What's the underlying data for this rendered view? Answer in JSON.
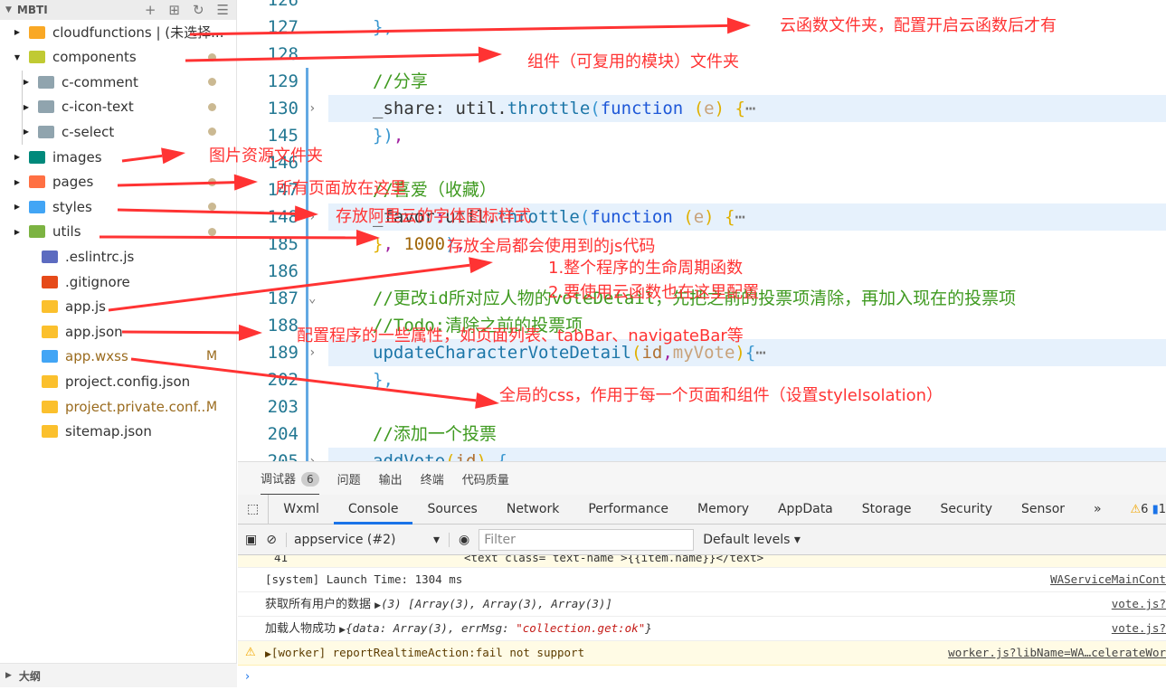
{
  "sidebar": {
    "project": "MBTI",
    "items": [
      {
        "label": "cloudfunctions | (未选择...",
        "icon": "cloud-folder-icon",
        "color": "#f9a825",
        "open": false,
        "depth": 0
      },
      {
        "label": "components",
        "icon": "components-folder-icon",
        "color": "#c0ca33",
        "open": true,
        "depth": 0,
        "dot": true
      },
      {
        "label": "c-comment",
        "icon": "folder-icon",
        "color": "#90a4ae",
        "open": false,
        "depth": 1,
        "dot": true
      },
      {
        "label": "c-icon-text",
        "icon": "folder-icon",
        "color": "#90a4ae",
        "open": false,
        "depth": 1,
        "dot": true
      },
      {
        "label": "c-select",
        "icon": "folder-icon",
        "color": "#90a4ae",
        "open": false,
        "depth": 1,
        "dot": true
      },
      {
        "label": "images",
        "icon": "images-folder-icon",
        "color": "#00897b",
        "open": false,
        "depth": 0
      },
      {
        "label": "pages",
        "icon": "pages-folder-icon",
        "color": "#ff7043",
        "open": false,
        "depth": 0,
        "dot": true
      },
      {
        "label": "styles",
        "icon": "styles-folder-icon",
        "color": "#42a5f5",
        "open": false,
        "depth": 0,
        "dot": true
      },
      {
        "label": "utils",
        "icon": "utils-folder-icon",
        "color": "#7cb342",
        "open": false,
        "depth": 0,
        "dot": true
      },
      {
        "label": ".eslintrc.js",
        "icon": "eslint-icon",
        "color": "#5c6bc0",
        "file": true
      },
      {
        "label": ".gitignore",
        "icon": "git-icon",
        "color": "#e64a19",
        "file": true
      },
      {
        "label": "app.js",
        "icon": "js-file-icon",
        "color": "#fbc02d",
        "file": true
      },
      {
        "label": "app.json",
        "icon": "json-file-icon",
        "color": "#fbc02d",
        "file": true
      },
      {
        "label": "app.wxss",
        "icon": "css-file-icon",
        "color": "#42a5f5",
        "file": true,
        "status": "M"
      },
      {
        "label": "project.config.json",
        "icon": "json-file-icon",
        "color": "#fbc02d",
        "file": true
      },
      {
        "label": "project.private.conf...",
        "icon": "json-file-icon",
        "color": "#fbc02d",
        "file": true,
        "status": "M"
      },
      {
        "label": "sitemap.json",
        "icon": "json-file-icon",
        "color": "#fbc02d",
        "file": true
      }
    ],
    "outline": "大纲"
  },
  "editor": {
    "lines": [
      {
        "n": "126",
        "tokens": []
      },
      {
        "n": "127",
        "tokens": [
          [
            "},",
            "br"
          ]
        ]
      },
      {
        "n": "128",
        "tokens": []
      },
      {
        "n": "129",
        "tokens": [
          [
            "//分享",
            "cm"
          ]
        ]
      },
      {
        "n": "130",
        "fold": "right",
        "hl": true,
        "tokens": [
          [
            "_share",
            "pl"
          ],
          [
            ": ",
            "pl"
          ],
          [
            "util",
            "pl"
          ],
          [
            ".",
            "pl"
          ],
          [
            "throttle",
            "fn"
          ],
          [
            "(",
            "br"
          ],
          [
            "function",
            "kw"
          ],
          [
            " ",
            "pl"
          ],
          [
            "(",
            "br2"
          ],
          [
            "e",
            "pm2"
          ],
          [
            ")",
            "br2"
          ],
          [
            " ",
            "pl"
          ],
          [
            "{",
            "br2"
          ],
          [
            "⋯",
            "gy"
          ]
        ]
      },
      {
        "n": "145",
        "tokens": [
          [
            "})",
            "br"
          ],
          [
            ",",
            "pu"
          ]
        ]
      },
      {
        "n": "146",
        "tokens": []
      },
      {
        "n": "147",
        "tokens": [
          [
            "//喜爱（收藏）",
            "cm"
          ]
        ]
      },
      {
        "n": "148",
        "fold": "right",
        "hl": true,
        "tokens": [
          [
            "_favor",
            "pl"
          ],
          [
            ":",
            "pu"
          ],
          [
            "util",
            "pl"
          ],
          [
            ".",
            "pl"
          ],
          [
            "throttle",
            "fn"
          ],
          [
            "(",
            "br"
          ],
          [
            "function",
            "kw"
          ],
          [
            " ",
            "pl"
          ],
          [
            "(",
            "br2"
          ],
          [
            "e",
            "pm2"
          ],
          [
            ")",
            "br2"
          ],
          [
            " ",
            "pl"
          ],
          [
            "{",
            "br2"
          ],
          [
            "⋯",
            "gy"
          ]
        ]
      },
      {
        "n": "185",
        "tokens": [
          [
            "}",
            "br2"
          ],
          [
            ", ",
            "pu"
          ],
          [
            "1000",
            "nm"
          ],
          [
            ")",
            "br"
          ],
          [
            ",",
            "pu"
          ]
        ]
      },
      {
        "n": "186",
        "tokens": []
      },
      {
        "n": "187",
        "fold": "down",
        "tokens": [
          [
            "//更改id所对应人物的voteDetail，先把之前的投票项清除，再加入现在的投票项",
            "cm"
          ]
        ]
      },
      {
        "n": "188",
        "tokens": [
          [
            "//Todo:清除之前的投票项",
            "cm"
          ]
        ]
      },
      {
        "n": "189",
        "fold": "right",
        "hl": true,
        "tokens": [
          [
            "updateCharacterVoteDetail",
            "fn"
          ],
          [
            "(",
            "br2"
          ],
          [
            "id",
            "pm"
          ],
          [
            ",",
            "pu"
          ],
          [
            "myVote",
            "pm2"
          ],
          [
            ")",
            "br2"
          ],
          [
            "{",
            "br"
          ],
          [
            "⋯",
            "gy"
          ]
        ]
      },
      {
        "n": "202",
        "tokens": [
          [
            "},",
            "br"
          ]
        ]
      },
      {
        "n": "203",
        "tokens": []
      },
      {
        "n": "204",
        "tokens": [
          [
            "//添加一个投票",
            "cm"
          ]
        ]
      },
      {
        "n": "205",
        "fold": "right",
        "hl": true,
        "tokens": [
          [
            "addVote",
            "fn"
          ],
          [
            "(",
            "br2"
          ],
          [
            "id",
            "pm"
          ],
          [
            ")",
            "br2"
          ],
          [
            " {",
            "br"
          ]
        ]
      }
    ]
  },
  "panel": {
    "tabs": [
      {
        "label": "调试器",
        "badge": "6"
      },
      {
        "label": "问题"
      },
      {
        "label": "输出"
      },
      {
        "label": "终端"
      },
      {
        "label": "代码质量"
      }
    ],
    "devtools_tabs": [
      "Wxml",
      "Console",
      "Sources",
      "Network",
      "Performance",
      "Memory",
      "AppData",
      "Storage",
      "Security",
      "Sensor"
    ],
    "active_devtools_tab": "Console",
    "more": "»",
    "warn_count": "6",
    "info_count": "1",
    "context": "appservice (#2)",
    "filter_placeholder": "Filter",
    "levels": "Default levels",
    "console": {
      "snippet": {
        "line": "41",
        "code": "<text class= text-name >{{item.name}}</text>"
      },
      "rows": [
        {
          "msg": "[system] Launch Time: 1304 ms",
          "src": "WAServiceMainCont"
        },
        {
          "label": "获取所有用户的数据",
          "value": "(3) [Array(3), Array(3), Array(3)]",
          "src": "vote.js?"
        },
        {
          "label": "加载人物成功",
          "value_pre": "{data: Array(3), errMsg: ",
          "value_str": "\"collection.get:ok\"",
          "value_post": "}",
          "src": "vote.js?"
        },
        {
          "warn": true,
          "msg": "[worker] reportRealtimeAction:fail not support",
          "src": "worker.js?libName=WA…celerateWor"
        }
      ],
      "prompt": "›"
    }
  },
  "annotations": [
    "云函数文件夹，配置开启云函数后才有",
    "组件（可复用的模块）文件夹",
    "图片资源文件夹",
    "所有页面放在这里",
    "存放阿里云的字体图标样式",
    "存放全局都会使用到的js代码",
    "1.整个程序的生命周期函数",
    "2.要使用云函数也在这里配置",
    "配置程序的一些属性，如页面列表、tabBar、navigateBar等",
    "全局的css，作用于每一个页面和组件（设置styleIsolation）"
  ],
  "colors": {
    "annotation": "#ff3333",
    "accent": "#1a73e8",
    "comment": "#3f9a20"
  }
}
